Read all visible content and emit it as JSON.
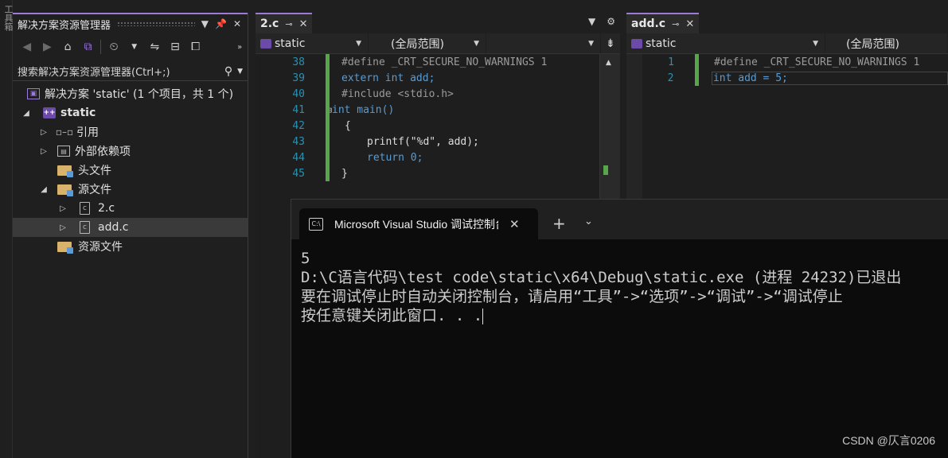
{
  "toolbox": {
    "label": "工具箱"
  },
  "solution_explorer": {
    "title": "解决方案资源管理器",
    "search_placeholder": "搜索解决方案资源管理器(Ctrl+;)",
    "tree": [
      {
        "label": "解决方案 'static' (1 个项目，共 1 个)"
      },
      {
        "label": "static"
      },
      {
        "label": "引用"
      },
      {
        "label": "外部依赖项"
      },
      {
        "label": "头文件"
      },
      {
        "label": "源文件"
      },
      {
        "label": "2.c"
      },
      {
        "label": "add.c"
      },
      {
        "label": "资源文件"
      }
    ]
  },
  "editor_left": {
    "tab": "2.c",
    "nav_project": "static",
    "nav_scope": "(全局范围)",
    "lines": [
      {
        "n": "38",
        "code": "#define _CRT_SECURE_NO_WARNINGS 1"
      },
      {
        "n": "39",
        "code": "extern int add;"
      },
      {
        "n": "40",
        "code": "#include <stdio.h>"
      },
      {
        "n": "41",
        "code": "int main()"
      },
      {
        "n": "42",
        "code": "{"
      },
      {
        "n": "43",
        "code": "printf(\"%d\", add);"
      },
      {
        "n": "44",
        "code": "return 0;"
      },
      {
        "n": "45",
        "code": "}"
      }
    ]
  },
  "editor_right": {
    "tab": "add.c",
    "nav_project": "static",
    "nav_scope": "(全局范围)",
    "lines": [
      {
        "n": "1",
        "code": "#define _CRT_SECURE_NO_WARNINGS 1"
      },
      {
        "n": "2",
        "code": "int add = 5;"
      }
    ]
  },
  "console": {
    "tab_title": "Microsoft Visual Studio 调试控制台",
    "lines": [
      "5",
      "D:\\C语言代码\\test code\\static\\x64\\Debug\\static.exe (进程 24232)已退出",
      "要在调试停止时自动关闭控制台，请启用“工具”->“选项”->“调试”->“调试停止",
      "按任意键关闭此窗口. . ."
    ]
  },
  "watermark": "CSDN @仄言0206",
  "colors": {
    "accent": "#9b7ad8",
    "keyword": "#569cd6",
    "string": "#d69d85",
    "line_number": "#2b91af",
    "changed_bar": "#57a64a",
    "breakpoint": "#e51400"
  }
}
